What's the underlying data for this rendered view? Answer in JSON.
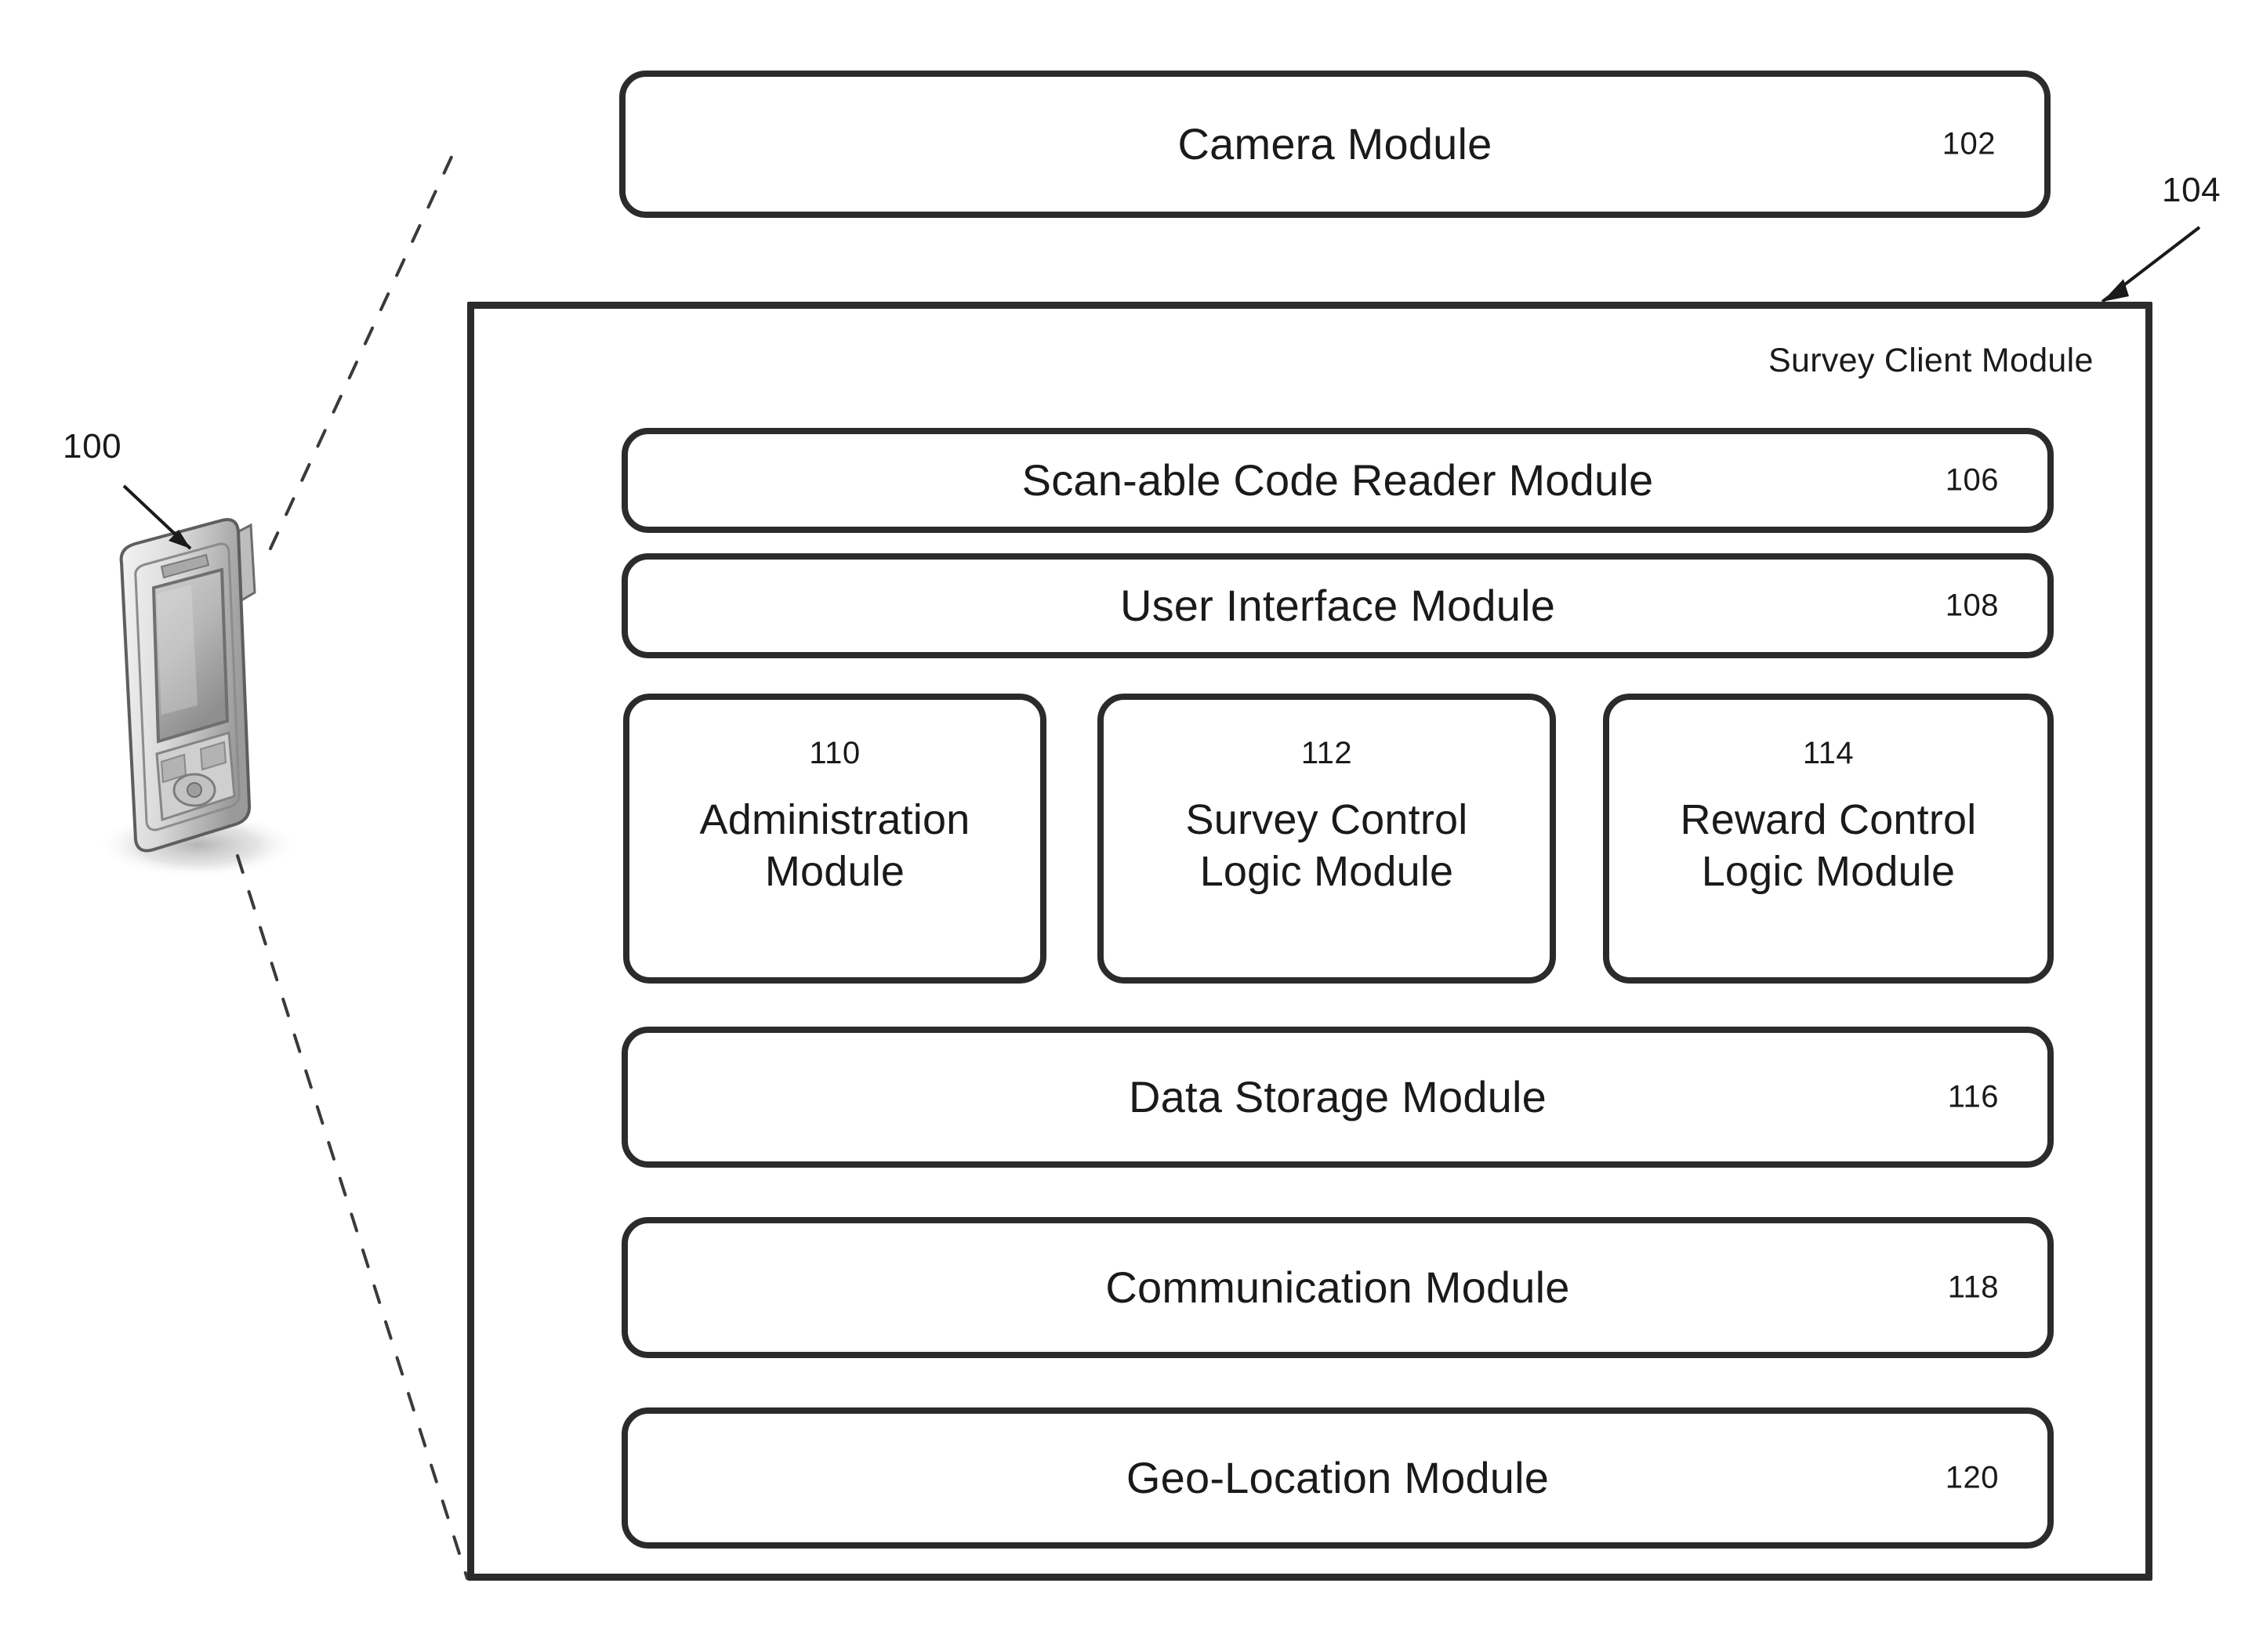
{
  "figure": {
    "type": "patent-block-diagram",
    "background_color": "#ffffff",
    "line_color": "#2b2b2b"
  },
  "device": {
    "ref": "100",
    "name": "mobile-phone-illustration"
  },
  "camera_module": {
    "label": "Camera Module",
    "ref": "102"
  },
  "client_container": {
    "title": "Survey Client Module",
    "ref": "104"
  },
  "modules": [
    {
      "label": "Scan-able Code Reader Module",
      "ref": "106"
    },
    {
      "label": "User Interface Module",
      "ref": "108"
    },
    {
      "label": "Data Storage Module",
      "ref": "116"
    },
    {
      "label": "Communication Module",
      "ref": "118"
    },
    {
      "label": "Geo-Location Module",
      "ref": "120"
    }
  ],
  "logic_modules": [
    {
      "ref": "110",
      "line1": "Administration",
      "line2": "Module"
    },
    {
      "ref": "112",
      "line1": "Survey Control",
      "line2": "Logic Module"
    },
    {
      "ref": "114",
      "line1": "Reward Control",
      "line2": "Logic Module"
    }
  ]
}
